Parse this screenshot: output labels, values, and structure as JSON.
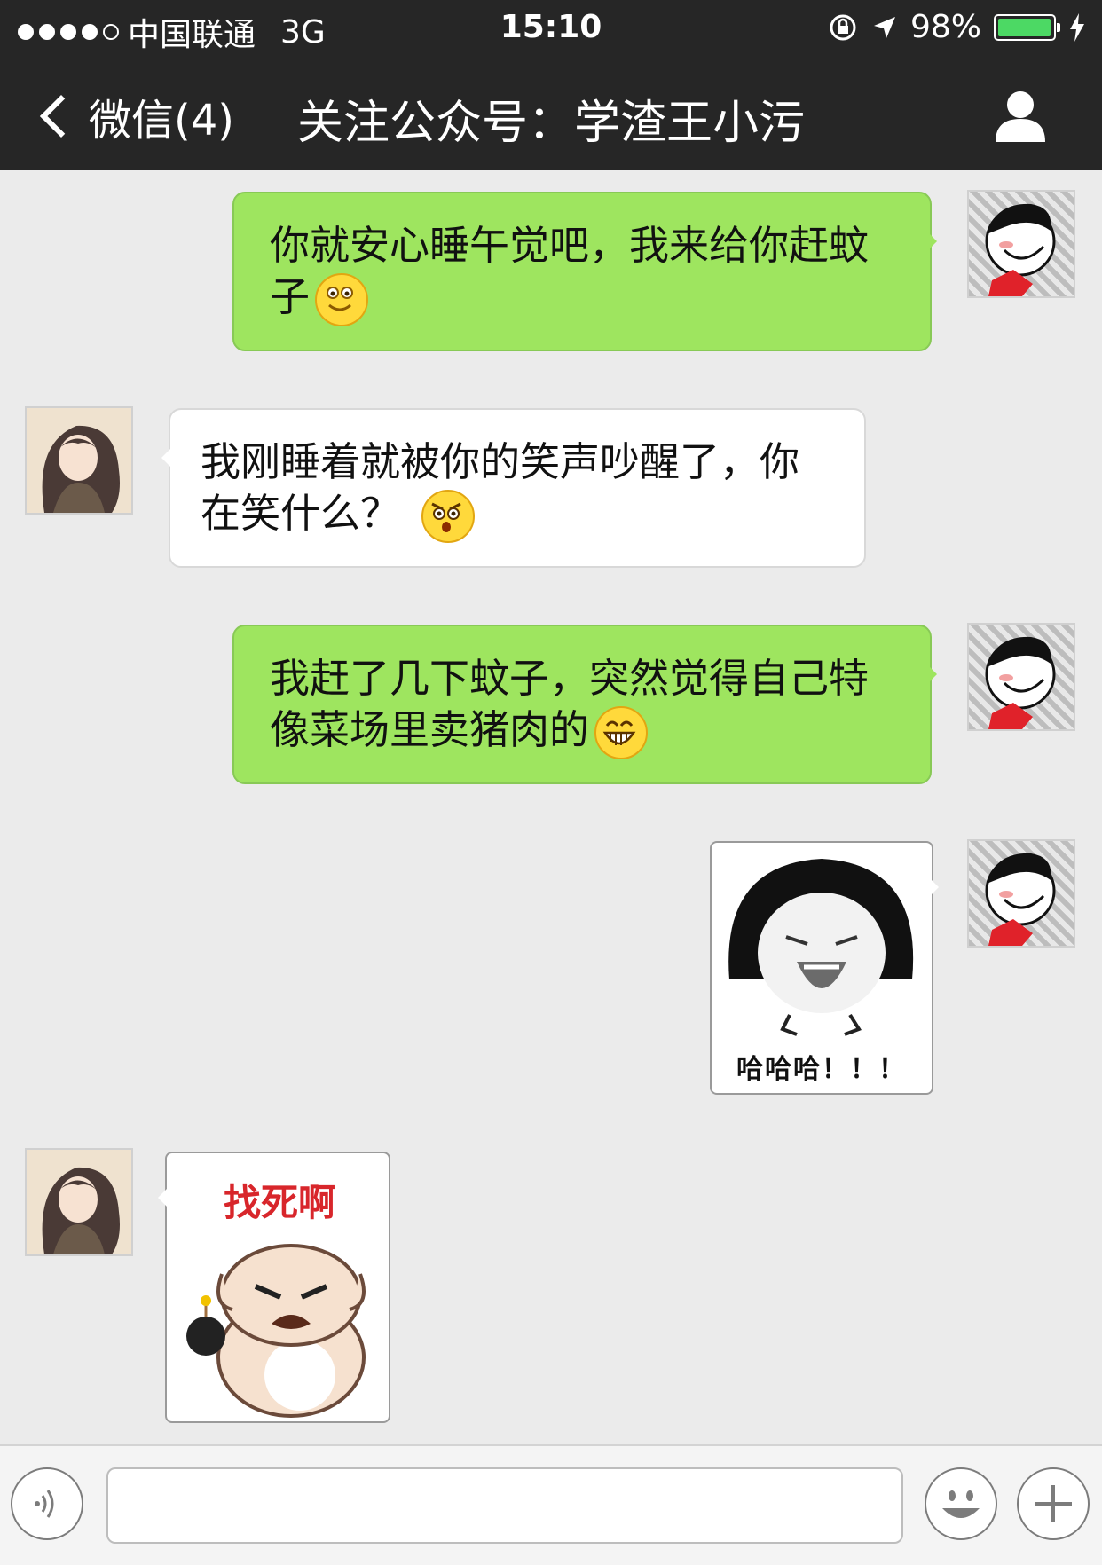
{
  "status_bar": {
    "carrier": "中国联通",
    "network": "3G",
    "time": "15:10",
    "battery": "98%",
    "battery_level": 0.98
  },
  "nav": {
    "back_label": "微信(4)",
    "title": "关注公众号：学渣王小污"
  },
  "messages": [
    {
      "side": "right",
      "type": "text",
      "lines": [
        "你就安心睡午觉吧，我来给你赶蚊",
        "子"
      ],
      "emoji": "smile-emoji"
    },
    {
      "side": "left",
      "type": "text",
      "lines": [
        "我刚睡着就被你的笑声吵醒了，你",
        "在笑什么？"
      ],
      "emoji": "shocked-emoji"
    },
    {
      "side": "right",
      "type": "text",
      "lines": [
        "我赶了几下蚊子，突然觉得自己特",
        "像菜场里卖猪肉的"
      ],
      "emoji": "grin-emoji"
    },
    {
      "side": "right",
      "type": "sticker",
      "caption": "哈哈哈！！！"
    },
    {
      "side": "left",
      "type": "sticker",
      "caption": "找死啊"
    }
  ],
  "colors": {
    "sent_bubble": "#9ee55f",
    "received_bubble": "#ffffff",
    "header": "#262626",
    "background": "#ebebeb"
  }
}
